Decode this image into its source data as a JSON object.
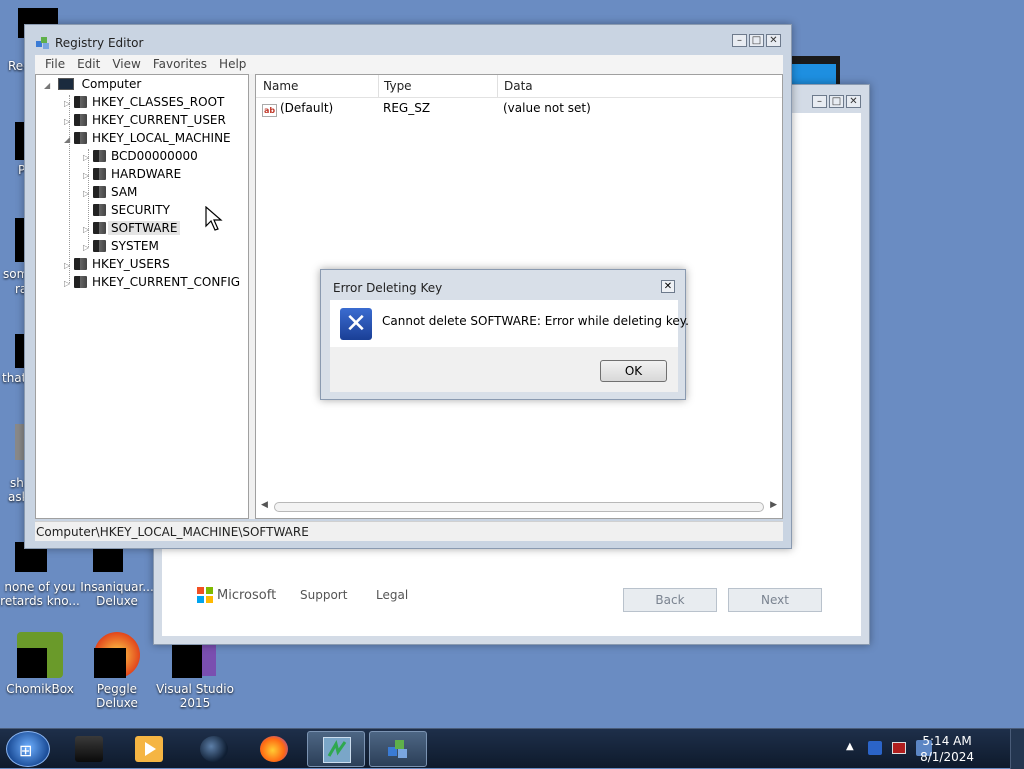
{
  "desktop": {
    "icons": [
      {
        "label": "none of you retards kno...",
        "clip": ""
      },
      {
        "label": "Insaniquar... Deluxe"
      },
      {
        "label": "ChomikBox"
      },
      {
        "label": "Peggle Deluxe"
      },
      {
        "label": "Visual Studio 2015"
      }
    ],
    "clipped_labels": [
      "Rec",
      "P",
      "som",
      "ra",
      "that",
      "sh",
      "ask"
    ]
  },
  "registry": {
    "title": "Registry Editor",
    "menu": [
      "File",
      "Edit",
      "View",
      "Favorites",
      "Help"
    ],
    "tree": {
      "root": "Computer",
      "hives": [
        "HKEY_CLASSES_ROOT",
        "HKEY_CURRENT_USER",
        "HKEY_LOCAL_MACHINE",
        "HKEY_USERS",
        "HKEY_CURRENT_CONFIG"
      ],
      "hklm_children": [
        "BCD00000000",
        "HARDWARE",
        "SAM",
        "SECURITY",
        "SOFTWARE",
        "SYSTEM"
      ],
      "selected": "SOFTWARE"
    },
    "columns": [
      "Name",
      "Type",
      "Data"
    ],
    "rows": [
      {
        "name": "(Default)",
        "type": "REG_SZ",
        "data": "(value not set)"
      }
    ],
    "status": "Computer\\HKEY_LOCAL_MACHINE\\SOFTWARE"
  },
  "dialog": {
    "title": "Error Deleting Key",
    "message": "Cannot delete SOFTWARE:  Error while deleting key.",
    "ok_label": "OK"
  },
  "setup": {
    "brand": "Microsoft",
    "links": [
      "Support",
      "Legal"
    ],
    "back_label": "Back",
    "next_label": "Next"
  },
  "taskbar": {
    "time": "5:14 AM",
    "date": "8/1/2024"
  }
}
